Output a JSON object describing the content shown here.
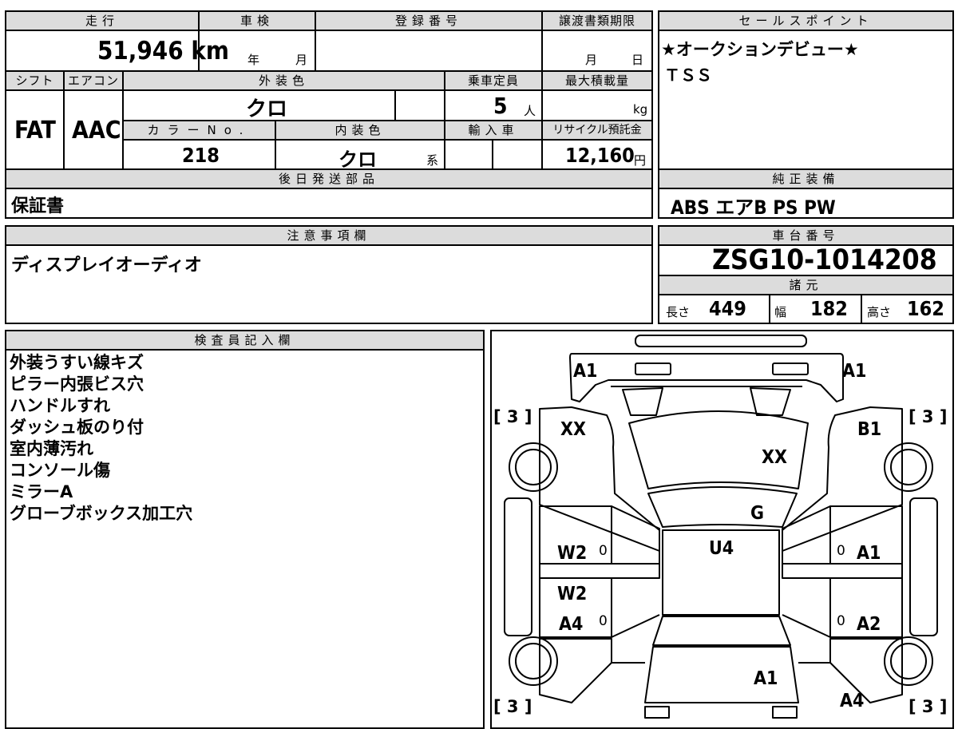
{
  "top": {
    "mileage_label": "走行",
    "mileage_value": "51,946",
    "mileage_unit": "km",
    "shaken_label": "車検",
    "shaken_year": "年",
    "shaken_month": "月",
    "reg_label": "登録番号",
    "transfer_label": "譲渡書類期限",
    "transfer_month": "月",
    "transfer_day": "日",
    "shift_label": "シフト",
    "aircon_label": "エアコン",
    "ext_color_label": "外装色",
    "capacity_label": "乗車定員",
    "maxload_label": "最大積載量",
    "shift_value": "FAT",
    "aircon_value": "AAC",
    "ext_color_value": "クロ",
    "capacity_value": "5",
    "capacity_unit": "人",
    "maxload_unit": "kg",
    "color_no_label": "カラーNo.",
    "int_color_label": "内装色",
    "import_label": "輸入車",
    "recycle_label": "リサイクル預託金",
    "color_no_value": "218",
    "int_color_value": "クロ",
    "int_color_suffix": "系",
    "recycle_value": "12,160",
    "recycle_unit": "円",
    "later_label": "後日発送部品",
    "later_value": "保証書"
  },
  "sales": {
    "label": "セールスポイント",
    "line1": "★オークションデビュー★",
    "line2": "ＴＳＳ"
  },
  "equip": {
    "label": "純正装備",
    "value": "ABS エアB PS PW"
  },
  "caution": {
    "label": "注意事項欄",
    "value": "ディスプレイオーディオ"
  },
  "chassis": {
    "label": "車台番号",
    "value": "ZSG10-1014208",
    "specs_label": "諸元",
    "length_label": "長さ",
    "length_value": "449",
    "width_label": "幅",
    "width_value": "182",
    "height_label": "高さ",
    "height_value": "162"
  },
  "inspector": {
    "label": "検査員記入欄",
    "notes": [
      "外装うすい線キズ",
      "ピラー内張ビス穴",
      "ハンドルすれ",
      "ダッシュ板のり付",
      "室内薄汚れ",
      "コンソール傷",
      "ミラーA",
      "グローブボックス加工穴"
    ]
  },
  "diagram": {
    "tire_fl": "[ 3 ]",
    "tire_fr": "[ 3 ]",
    "tire_rl": "[ 3 ]",
    "tire_rr": "[ 3 ]",
    "bumper_left": "A1",
    "bumper_right": "A1",
    "fender_left": "XX",
    "fender_right": "B1",
    "hood": "XX",
    "windshield": "G",
    "roof": "U4",
    "front_door_left": "W2",
    "front_door_right": "A1",
    "rear_door_left_1": "W2",
    "rear_door_left_2": "A4",
    "rear_door_right": "A2",
    "trunk": "A1",
    "quarter_right": "A4",
    "zero": "0"
  }
}
